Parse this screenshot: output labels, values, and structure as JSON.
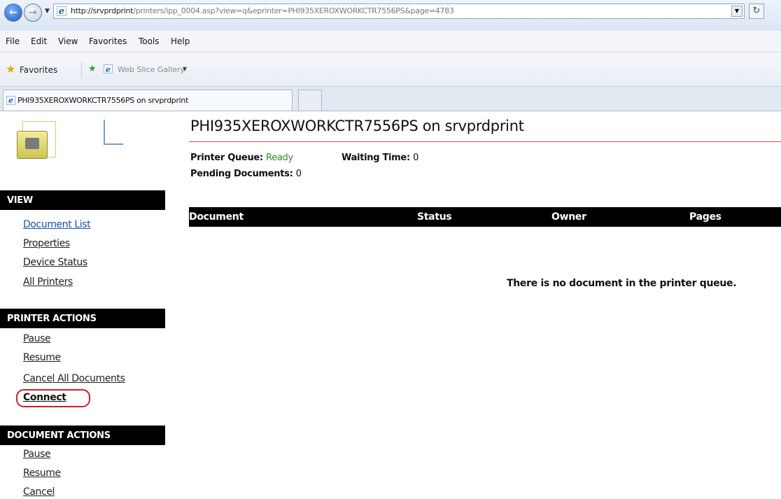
{
  "browser": {
    "url_host": "http://srvprdprint",
    "url_path": "/printers/ipp_0004.asp?view=q&eprinter=PHI935XEROXWORKCTR7556PS&page=4783",
    "menu": [
      "File",
      "Edit",
      "View",
      "Favorites",
      "Tools",
      "Help"
    ],
    "favorites_label": "Favorites",
    "web_slice_label": "Web Slice Gallery",
    "tab_title": "PHI935XEROXWORKCTR7556PS on srvprdprint"
  },
  "sidebar": {
    "view_header": "VIEW",
    "view_links": [
      "Document List",
      "Properties",
      "Device Status",
      "All Printers"
    ],
    "printer_actions_header": "PRINTER ACTIONS",
    "printer_actions": [
      "Pause",
      "Resume",
      "Cancel All Documents",
      "Connect"
    ],
    "document_actions_header": "DOCUMENT ACTIONS",
    "document_actions": [
      "Pause",
      "Resume",
      "Cancel"
    ]
  },
  "main": {
    "title": "PHI935XEROXWORKCTR7556PS on srvprdprint",
    "queue_label": "Printer Queue:",
    "queue_value": "Ready",
    "waiting_label": "Waiting Time:",
    "waiting_value": "0",
    "pending_label": "Pending Documents:",
    "pending_value": "0",
    "columns": [
      "Document",
      "Status",
      "Owner",
      "Pages"
    ],
    "empty_message": "There is no document in the printer queue."
  },
  "colors": {
    "status_ready": "#2e8b2e",
    "highlight_ring": "#d41f2a",
    "title_rule": "#d94a56"
  }
}
